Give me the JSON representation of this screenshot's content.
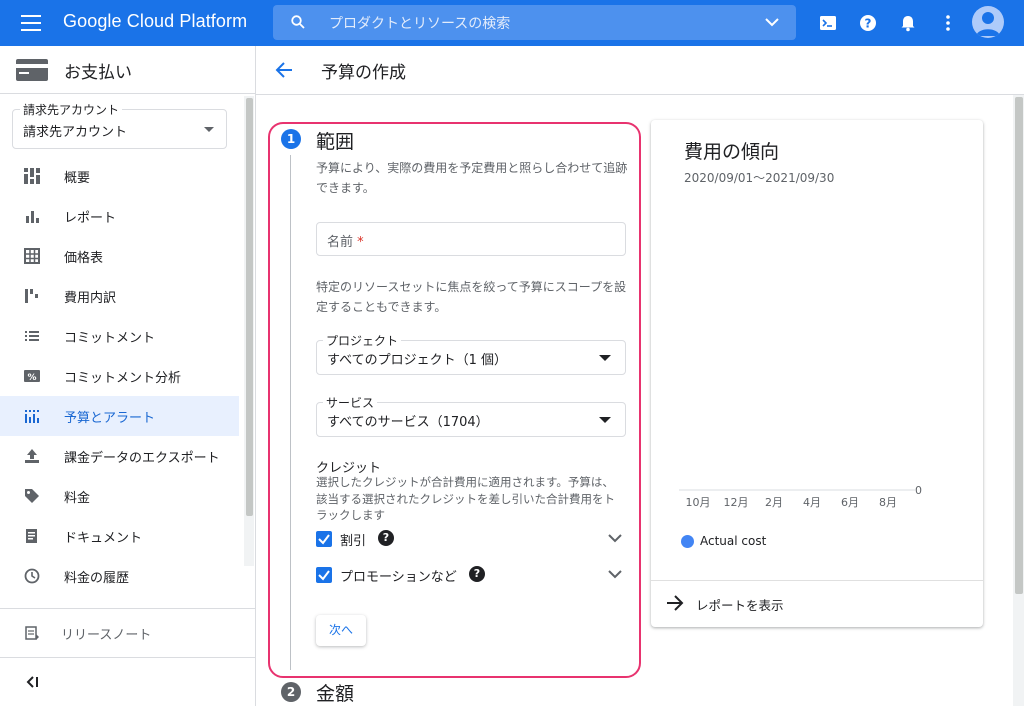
{
  "topbar": {
    "brand": "Google Cloud Platform",
    "search_placeholder": "プロダクトとリソースの検索"
  },
  "sidebar": {
    "title": "お支払い",
    "account": {
      "label": "請求先アカウント",
      "value": "請求先アカウント"
    },
    "items": [
      {
        "id": "overview",
        "label": "概要",
        "icon": "dashboard-icon"
      },
      {
        "id": "reports",
        "label": "レポート",
        "icon": "bar-chart-icon"
      },
      {
        "id": "pricing",
        "label": "価格表",
        "icon": "table-icon"
      },
      {
        "id": "cost-breakdown",
        "label": "費用内訳",
        "icon": "waterfall-icon"
      },
      {
        "id": "commitments",
        "label": "コミットメント",
        "icon": "list-icon"
      },
      {
        "id": "commitment-analysis",
        "label": "コミットメント分析",
        "icon": "percent-icon"
      },
      {
        "id": "budgets",
        "label": "予算とアラート",
        "icon": "budget-icon",
        "active": true
      },
      {
        "id": "export",
        "label": "課金データのエクスポート",
        "icon": "upload-icon"
      },
      {
        "id": "pricing-tag",
        "label": "料金",
        "icon": "tag-icon"
      },
      {
        "id": "documents",
        "label": "ドキュメント",
        "icon": "document-icon"
      },
      {
        "id": "history",
        "label": "料金の履歴",
        "icon": "clock-icon"
      }
    ],
    "release_notes": "リリースノート"
  },
  "page": {
    "title": "予算の作成"
  },
  "step1": {
    "number": "1",
    "title": "範囲",
    "description": "予算により、実際の費用を予定費用と照らし合わせて追跡できます。",
    "name_placeholder": "名前",
    "name_required": "*",
    "scope_description": "特定のリソースセットに焦点を絞って予算にスコープを設定することもできます。",
    "project": {
      "label": "プロジェクト",
      "value": "すべてのプロジェクト（1 個）"
    },
    "service": {
      "label": "サービス",
      "value": "すべてのサービス（1704）"
    },
    "credits_title": "クレジット",
    "credits_description": "選択したクレジットが合計費用に適用されます。予算は、該当する選択されたクレジットを差し引いた合計費用をトラックします",
    "credits": [
      {
        "label": "割引",
        "checked": true
      },
      {
        "label": "プロモーションなど",
        "checked": true
      }
    ],
    "next_label": "次へ"
  },
  "step2": {
    "number": "2",
    "title": "金額"
  },
  "trend": {
    "title": "費用の傾向",
    "range": "2020/09/01～2021/09/30",
    "report_link": "レポートを表示"
  },
  "chart_data": {
    "type": "line",
    "categories": [
      "10月",
      "12月",
      "2月",
      "4月",
      "6月",
      "8月"
    ],
    "series": [
      {
        "name": "Actual cost",
        "values": [
          0,
          0,
          0,
          0,
          0,
          0
        ],
        "color": "#4285f4"
      }
    ],
    "yticks": [
      "0"
    ],
    "ylim": [
      0,
      0
    ],
    "grid": false,
    "legend": "bottom-left"
  },
  "colors": {
    "primary": "#1a73e8",
    "highlight": "#e8336f",
    "active_bg": "#e8f0fe"
  }
}
